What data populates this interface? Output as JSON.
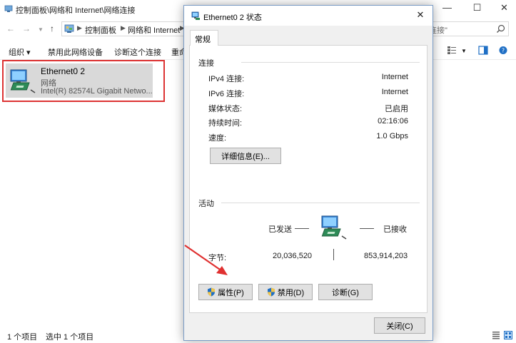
{
  "explorer": {
    "title": "控制面板\\网络和 Internet\\网络连接",
    "breadcrumbs": [
      "控制面板",
      "网络和 Internet"
    ],
    "search_placeholder": "连接\"",
    "commands": [
      "组织 ▾",
      "禁用此网络设备",
      "诊断这个连接",
      "重命"
    ],
    "selected_item": {
      "name": "Ethernet0 2",
      "type": "网络",
      "device": "Intel(R) 82574L Gigabit Netwo..."
    },
    "status": {
      "item_count": "1 个项目",
      "selected_count": "选中 1 个项目"
    }
  },
  "dialog": {
    "title": "Ethernet0 2 状态",
    "tab": "常规",
    "connection": {
      "title": "连接",
      "rows": [
        {
          "label": "IPv4 连接:",
          "value": "Internet"
        },
        {
          "label": "IPv6 连接:",
          "value": "Internet"
        },
        {
          "label": "媒体状态:",
          "value": "已启用"
        },
        {
          "label": "持续时间:",
          "value": "02:16:06"
        },
        {
          "label": "速度:",
          "value": "1.0 Gbps"
        }
      ],
      "details_button": "详细信息(E)..."
    },
    "activity": {
      "title": "活动",
      "sent_label": "已发送",
      "received_label": "已接收",
      "bytes_label": "字节:",
      "bytes_sent": "20,036,520",
      "bytes_received": "853,914,203"
    },
    "buttons": {
      "properties": "属性(P)",
      "disable": "禁用(D)",
      "diagnose": "诊断(G)",
      "close": "关闭(C)"
    }
  },
  "colors": {
    "selection_bg": "#d9d9d9",
    "highlight_border": "#dd3333",
    "arrow": "#e03030"
  }
}
